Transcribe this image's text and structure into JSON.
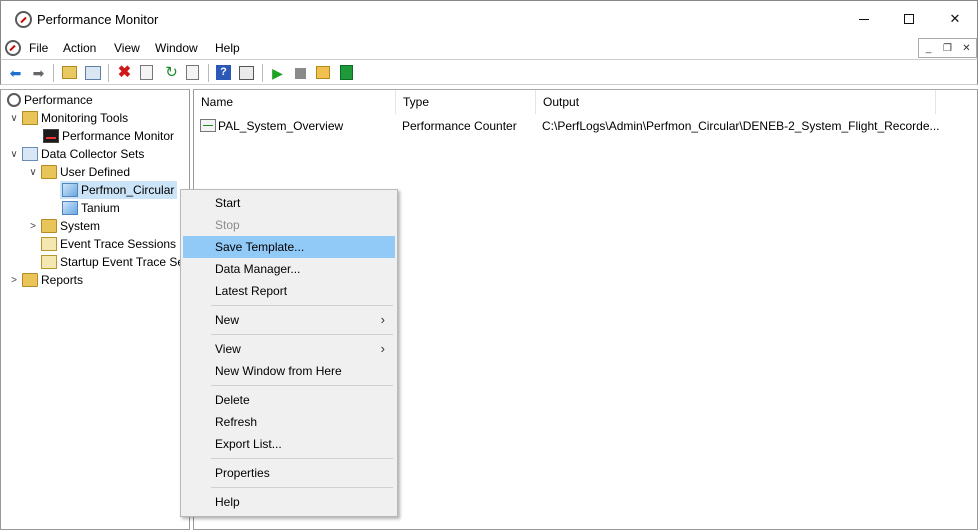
{
  "window": {
    "title": "Performance Monitor"
  },
  "menubar": {
    "items": [
      "File",
      "Action",
      "View",
      "Window",
      "Help"
    ]
  },
  "mdi": {
    "minimize": "_",
    "restore": "❐",
    "close": "✕"
  },
  "tree": {
    "items": [
      {
        "label": "Performance"
      },
      {
        "label": "Monitoring Tools"
      },
      {
        "label": "Performance Monitor"
      },
      {
        "label": "Data Collector Sets"
      },
      {
        "label": "User Defined"
      },
      {
        "label": "Perfmon_Circular"
      },
      {
        "label": "Tanium"
      },
      {
        "label": "System"
      },
      {
        "label": "Event Trace Sessions"
      },
      {
        "label": "Startup Event Trace Se"
      },
      {
        "label": "Reports"
      }
    ]
  },
  "list": {
    "columns": [
      "Name",
      "Type",
      "Output"
    ],
    "rows": [
      {
        "name": "PAL_System_Overview",
        "type": "Performance Counter",
        "output": "C:\\PerfLogs\\Admin\\Perfmon_Circular\\DENEB-2_System_Flight_Recorde..."
      }
    ]
  },
  "context_menu": {
    "items": [
      {
        "label": "Start"
      },
      {
        "label": "Stop"
      },
      {
        "label": "Save Template..."
      },
      {
        "label": "Data Manager..."
      },
      {
        "label": "Latest Report"
      },
      {
        "label": "New"
      },
      {
        "label": "View"
      },
      {
        "label": "New Window from Here"
      },
      {
        "label": "Delete"
      },
      {
        "label": "Refresh"
      },
      {
        "label": "Export List..."
      },
      {
        "label": "Properties"
      },
      {
        "label": "Help"
      }
    ]
  },
  "colors": {
    "highlight": "#91c9f7",
    "tree_selected": "#cce4f7",
    "menu_bg": "#f0f0f0",
    "disabled_text": "#8c8c8c"
  }
}
